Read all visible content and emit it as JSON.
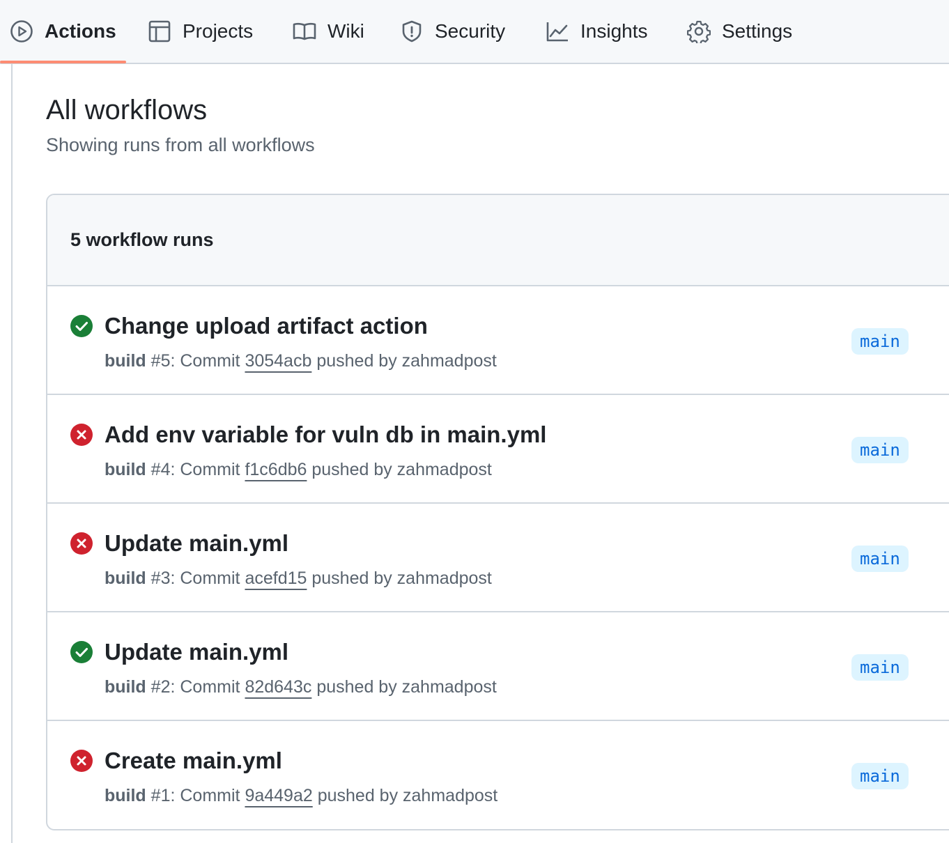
{
  "nav": {
    "tabs": [
      {
        "label": "Actions",
        "icon": "play-icon",
        "active": true
      },
      {
        "label": "Projects",
        "icon": "table-icon"
      },
      {
        "label": "Wiki",
        "icon": "book-icon"
      },
      {
        "label": "Security",
        "icon": "shield-icon"
      },
      {
        "label": "Insights",
        "icon": "graph-icon"
      },
      {
        "label": "Settings",
        "icon": "gear-icon"
      }
    ],
    "active_color": "#fd8c73"
  },
  "page": {
    "title": "All workflows",
    "subtitle": "Showing runs from all workflows"
  },
  "runs_box": {
    "header": "5 workflow runs",
    "runs": [
      {
        "status": "success",
        "title": "Change upload artifact action",
        "workflow": "build",
        "run_number": "#5",
        "commit_prefix": ": Commit",
        "sha": "3054acb",
        "pushed_by": "pushed by zahmadpost",
        "branch": "main"
      },
      {
        "status": "failure",
        "title": "Add env variable for vuln db in main.yml",
        "workflow": "build",
        "run_number": "#4",
        "commit_prefix": ": Commit",
        "sha": "f1c6db6",
        "pushed_by": "pushed by zahmadpost",
        "branch": "main"
      },
      {
        "status": "failure",
        "title": "Update main.yml",
        "workflow": "build",
        "run_number": "#3",
        "commit_prefix": ": Commit",
        "sha": "acefd15",
        "pushed_by": "pushed by zahmadpost",
        "branch": "main"
      },
      {
        "status": "success",
        "title": "Update main.yml",
        "workflow": "build",
        "run_number": "#2",
        "commit_prefix": ": Commit",
        "sha": "82d643c",
        "pushed_by": "pushed by zahmadpost",
        "branch": "main"
      },
      {
        "status": "failure",
        "title": "Create main.yml",
        "workflow": "build",
        "run_number": "#1",
        "commit_prefix": ": Commit",
        "sha": "9a449a2",
        "pushed_by": "pushed by zahmadpost",
        "branch": "main"
      }
    ]
  },
  "colors": {
    "success": "#1a7f37",
    "failure": "#cf222e",
    "branch_bg": "#ddf4ff",
    "branch_fg": "#0969da"
  }
}
